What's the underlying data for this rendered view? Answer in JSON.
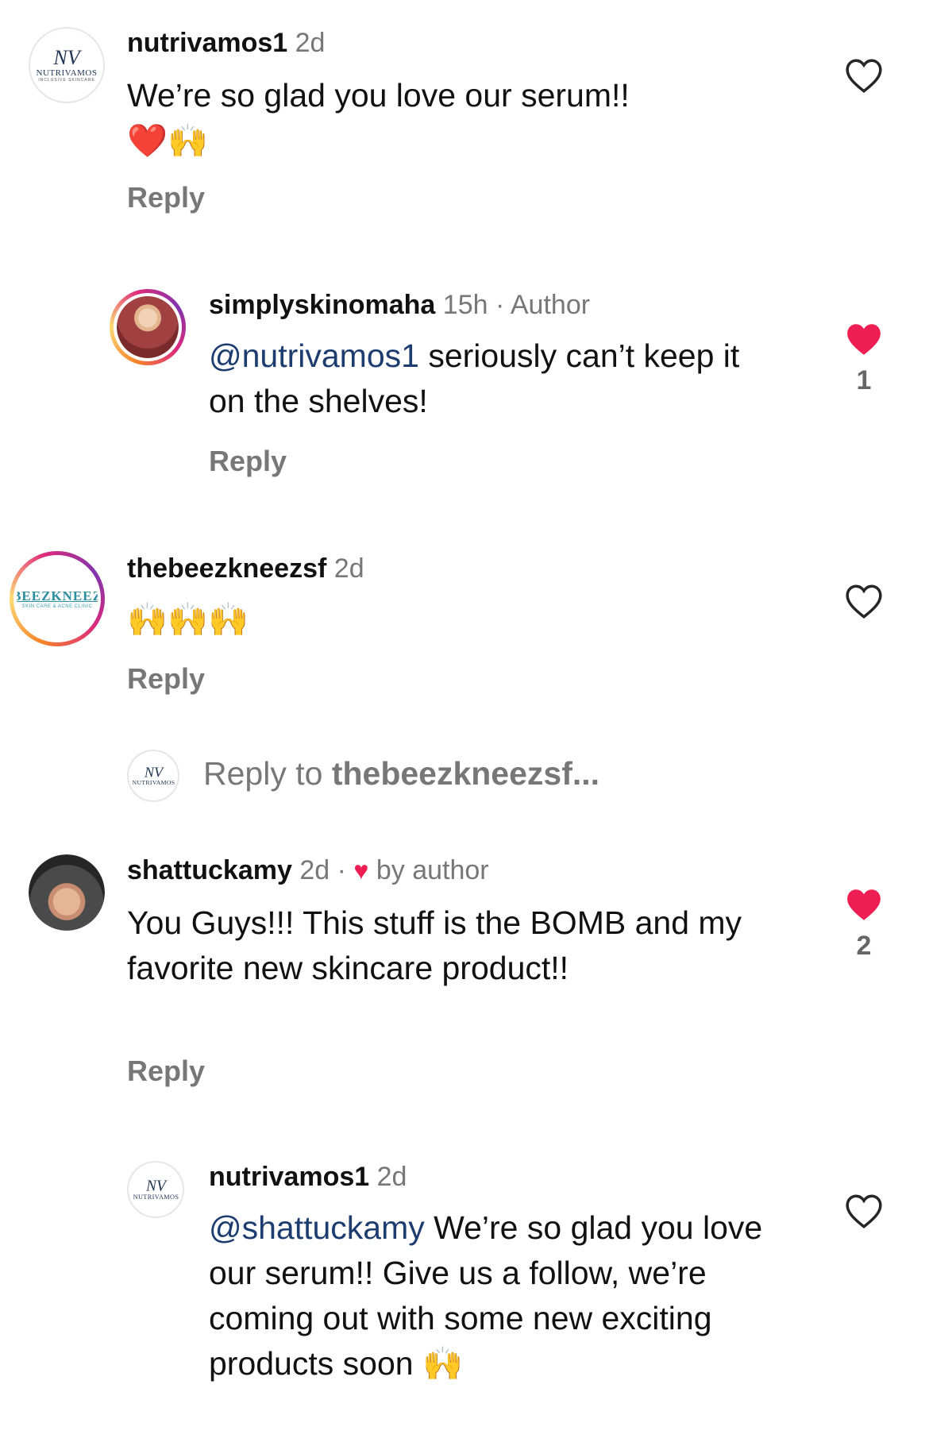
{
  "comments": [
    {
      "username": "nutrivamos1",
      "time": "2d",
      "extra": "",
      "mention": "",
      "text": "We’re so glad you love our serum!!",
      "emojis": "❤️🙌",
      "reply_label": "Reply",
      "liked": false,
      "like_count": "",
      "avatar": "nutrivamos-logo"
    },
    {
      "username": "simplyskinomaha",
      "time": "15h",
      "extra": " · Author",
      "mention": "@nutrivamos1",
      "text": " seriously can’t keep it on the shelves!",
      "emojis": "",
      "reply_label": "Reply",
      "liked": true,
      "like_count": "1",
      "avatar": "simplyskinomaha-photo"
    },
    {
      "username": "thebeezkneezsf",
      "time": "2d",
      "extra": "",
      "mention": "",
      "text": "",
      "emojis": "🙌🙌🙌",
      "reply_label": "Reply",
      "liked": false,
      "like_count": "",
      "avatar": "beezkneez-logo"
    },
    {
      "username": "shattuckamy",
      "time": "2d",
      "extra": "by author",
      "mention": "",
      "text": "You Guys!!! This stuff is the BOMB and my favorite new skincare product!!",
      "emojis": "",
      "reply_label": "Reply",
      "liked": true,
      "like_count": "2",
      "avatar": "shattuckamy-photo"
    },
    {
      "username": "nutrivamos1",
      "time": "2d",
      "extra": "",
      "mention": "@shattuckamy",
      "text": " We’re so glad you love our serum!! Give us a follow, we’re coming out with some new exciting products soon",
      "emojis": "🙌",
      "reply_label": "",
      "liked": false,
      "like_count": "",
      "avatar": "nutrivamos-logo"
    }
  ],
  "reply_to": {
    "prefix": "Reply to ",
    "username": "thebeezkneezsf..."
  },
  "logos": {
    "nutrivamos": {
      "mono": "NV",
      "word": "NUTRIVAMOS",
      "sub": "INCLUSIVE SKINCARE"
    },
    "beezkneez": {
      "top": "BEEZKNEEZ",
      "bot": "SKIN CARE & ACNE CLINIC"
    }
  },
  "colors": {
    "heart_liked": "#ee1d52",
    "mention": "#1d3d70",
    "muted": "#777777"
  }
}
